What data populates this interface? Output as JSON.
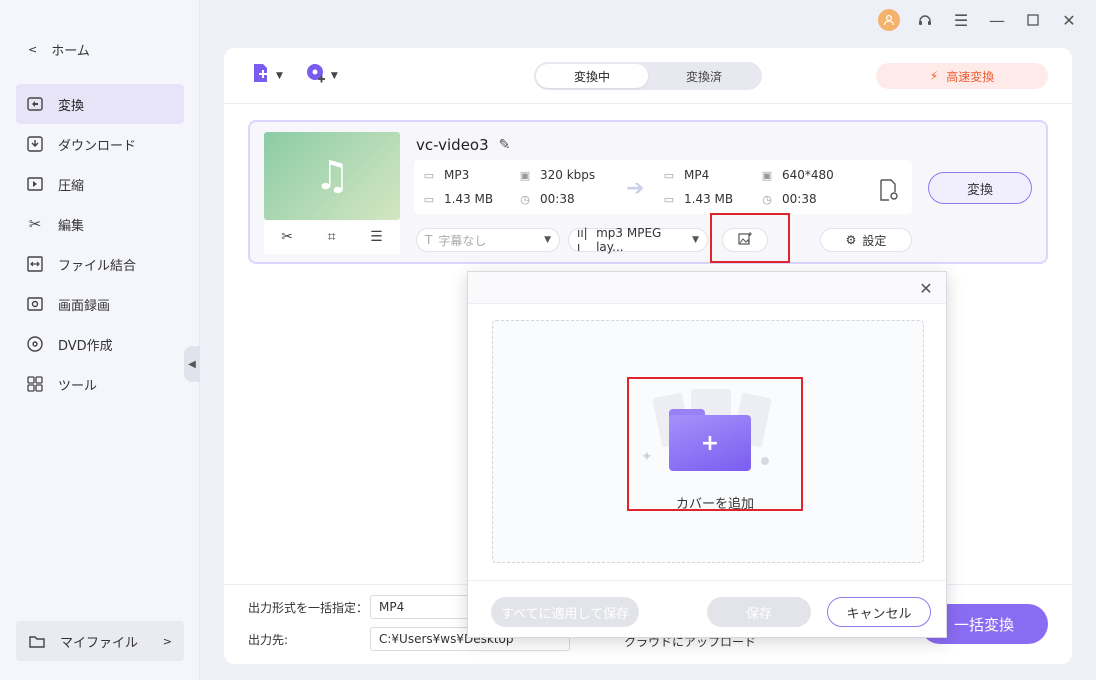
{
  "window": {
    "avatar_icon": "user-icon",
    "controls": [
      "support-icon",
      "menu-icon",
      "minimize-icon",
      "maximize-icon",
      "close-icon"
    ]
  },
  "sidebar": {
    "home_label": "ホーム",
    "items": [
      {
        "label": "変換",
        "icon": "convert-icon",
        "active": true
      },
      {
        "label": "ダウンロード",
        "icon": "download-icon",
        "active": false
      },
      {
        "label": "圧縮",
        "icon": "compress-icon",
        "active": false
      },
      {
        "label": "編集",
        "icon": "scissors-icon",
        "active": false
      },
      {
        "label": "ファイル結合",
        "icon": "merge-icon",
        "active": false
      },
      {
        "label": "画面録画",
        "icon": "record-icon",
        "active": false
      },
      {
        "label": "DVD作成",
        "icon": "dvd-icon",
        "active": false
      },
      {
        "label": "ツール",
        "icon": "tools-icon",
        "active": false
      }
    ],
    "myfile_label": "マイファイル"
  },
  "toolbar": {
    "tabs": [
      "変換中",
      "変換済"
    ],
    "active_tab": "変換中",
    "fast_convert": "高速変換",
    "accent": "#7b5cf0"
  },
  "file": {
    "name": "vc-video3",
    "source": {
      "format": "MP3",
      "size": "1.43 MB",
      "bitrate": "320 kbps",
      "duration": "00:38"
    },
    "target": {
      "format": "MP4",
      "size": "1.43 MB",
      "resolution": "640*480",
      "duration": "00:38"
    },
    "subtitle": "字幕なし",
    "audio": "mp3 MPEG lay...",
    "settings_label": "設定",
    "convert_label": "変換"
  },
  "footer": {
    "format_label": "出力形式を一括指定：",
    "format_value": "MP4",
    "dest_label": "出力先:",
    "dest_value": "C:¥Users¥ws¥Desktop",
    "cloud_label": "クラウドにアップロード",
    "batch_label": "一括変換"
  },
  "dialog": {
    "cover_label": "カバーを追加",
    "apply_all": "すべてに適用して保存",
    "save": "保存",
    "cancel": "キャンセル"
  }
}
